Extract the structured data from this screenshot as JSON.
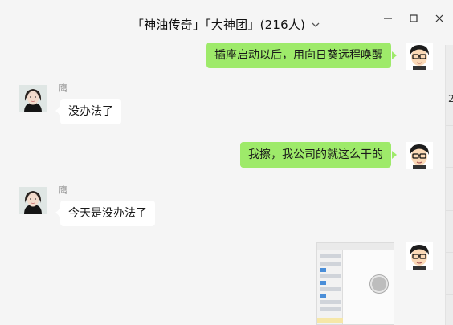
{
  "window": {
    "title": "「神油传奇」「大神团」(216人)"
  },
  "side_strip": {
    "text": "2"
  },
  "messages": [
    {
      "direction": "out",
      "text": "插座启动以后，用向日葵远程唤醒"
    },
    {
      "direction": "in",
      "sender": "鹰",
      "text": "没办法了"
    },
    {
      "direction": "out",
      "text": "我擦，我公司的就这么干的"
    },
    {
      "direction": "in",
      "sender": "鹰",
      "text": "今天是没办法了"
    },
    {
      "direction": "out",
      "type": "image"
    }
  ],
  "icons": {
    "dropdown": "chevron-down-icon",
    "minimize": "minimize-icon",
    "maximize": "maximize-icon",
    "close": "close-icon"
  },
  "colors": {
    "outgoing_bubble": "#9eea6a",
    "incoming_bubble": "#ffffff",
    "background": "#f5f5f5",
    "sender_name": "#9a9a9a"
  }
}
